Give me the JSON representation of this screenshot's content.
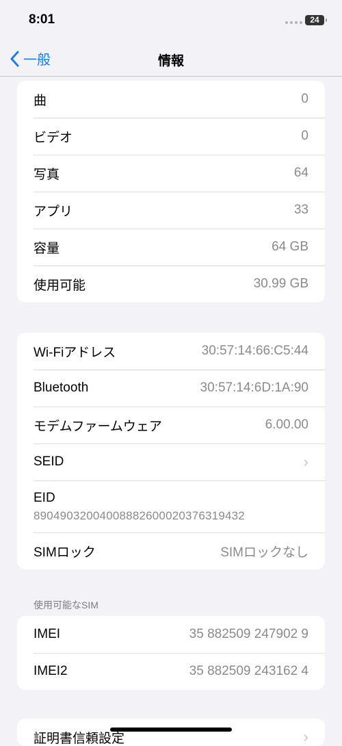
{
  "status": {
    "time": "8:01",
    "battery": "24"
  },
  "nav": {
    "back_label": "一般",
    "title": "情報"
  },
  "group1": [
    {
      "label": "曲",
      "value": "0"
    },
    {
      "label": "ビデオ",
      "value": "0"
    },
    {
      "label": "写真",
      "value": "64"
    },
    {
      "label": "アプリ",
      "value": "33"
    },
    {
      "label": "容量",
      "value": "64 GB"
    },
    {
      "label": "使用可能",
      "value": "30.99 GB"
    }
  ],
  "group2": {
    "wifi": {
      "label": "Wi-Fiアドレス",
      "value": "30:57:14:66:C5:44"
    },
    "bluetooth": {
      "label": "Bluetooth",
      "value": "30:57:14:6D:1A:90"
    },
    "modem": {
      "label": "モデムファームウェア",
      "value": "6.00.00"
    },
    "seid": {
      "label": "SEID"
    },
    "eid": {
      "label": "EID",
      "value": "89049032004008882600020376319432"
    },
    "simlock": {
      "label": "SIMロック",
      "value": "SIMロックなし"
    }
  },
  "sim_header": "使用可能なSIM",
  "group3": [
    {
      "label": "IMEI",
      "value": "35 882509 247902 9"
    },
    {
      "label": "IMEI2",
      "value": "35 882509 243162 4"
    }
  ],
  "group4": {
    "label": "証明書信頼設定"
  }
}
